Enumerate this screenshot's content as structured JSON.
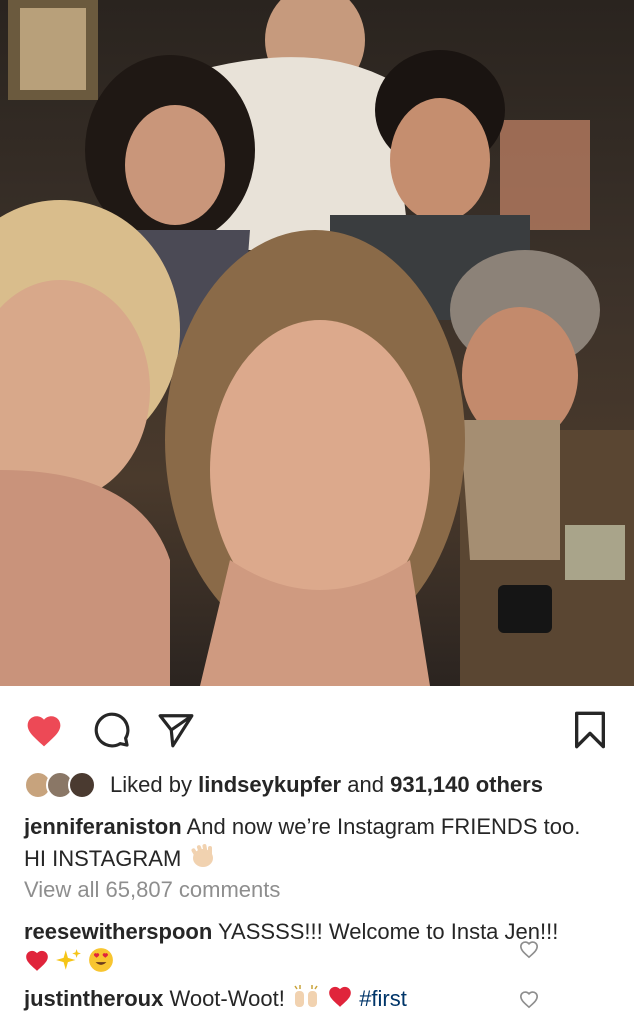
{
  "post": {
    "image_alt": "Group selfie photo",
    "actions": {
      "like_icon": "heart-filled-icon",
      "comment_icon": "comment-icon",
      "share_icon": "paper-plane-icon",
      "save_icon": "bookmark-icon",
      "like_color": "#ed4956"
    },
    "likes": {
      "prefix": "Liked by",
      "user": "lindseykupfer",
      "middle": "and",
      "others": "931,140 others"
    },
    "caption": {
      "user": "jenniferaniston",
      "text": "And now we’re Instagram FRIENDS too. HI INSTAGRAM"
    },
    "view_all": "View all 65,807 comments",
    "comments": [
      {
        "user": "reesewitherspoon",
        "text": "YASSSS!!! Welcome to Insta Jen!!!"
      },
      {
        "user": "justintheroux",
        "text": "Woot-Woot!",
        "hashtag": "#first"
      }
    ]
  }
}
